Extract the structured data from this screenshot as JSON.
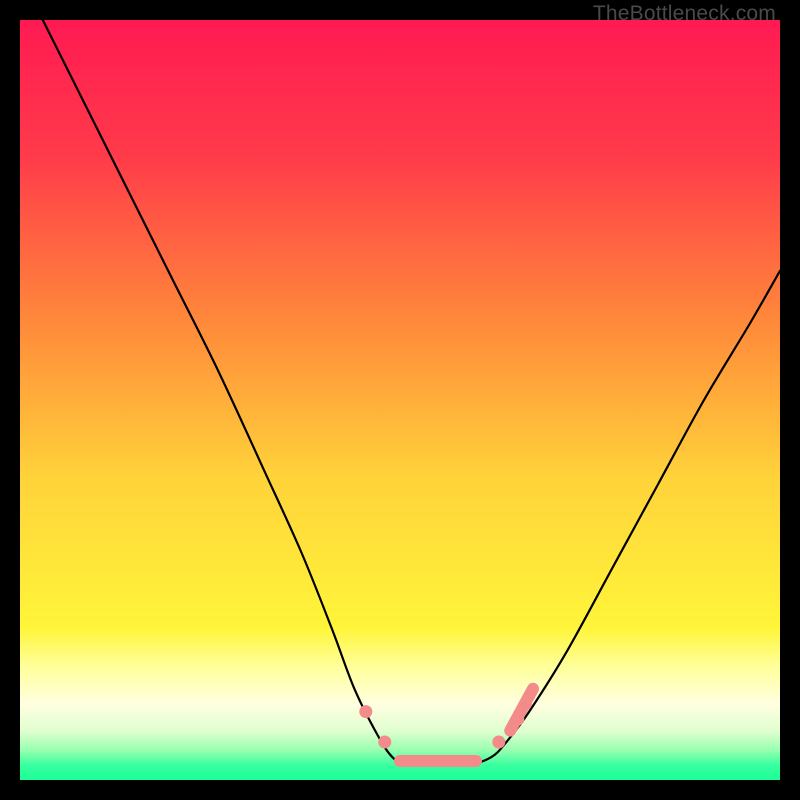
{
  "watermark": "TheBottleneck.com",
  "chart_data": {
    "type": "line",
    "title": "",
    "xlabel": "",
    "ylabel": "",
    "xlim": [
      0,
      100
    ],
    "ylim": [
      0,
      100
    ],
    "gradient_stops": [
      {
        "offset": 0,
        "color": "#ff1a52"
      },
      {
        "offset": 18,
        "color": "#ff3b4a"
      },
      {
        "offset": 40,
        "color": "#ff8a3a"
      },
      {
        "offset": 60,
        "color": "#ffd23a"
      },
      {
        "offset": 73,
        "color": "#ffe93a"
      },
      {
        "offset": 80,
        "color": "#fff53a"
      },
      {
        "offset": 85,
        "color": "#ffff99"
      },
      {
        "offset": 90,
        "color": "#ffffe0"
      },
      {
        "offset": 93.5,
        "color": "#e1ffd0"
      },
      {
        "offset": 96,
        "color": "#9affb0"
      },
      {
        "offset": 98,
        "color": "#3affa0"
      },
      {
        "offset": 100,
        "color": "#1aff98"
      }
    ],
    "series": [
      {
        "name": "bottleneck-curve",
        "x": [
          3,
          8,
          14,
          20,
          26,
          32,
          37,
          41,
          44,
          47,
          49,
          51,
          55,
          59,
          62,
          64,
          67,
          72,
          78,
          84,
          90,
          96,
          100
        ],
        "y": [
          100,
          90,
          78,
          66,
          54,
          41,
          30,
          20,
          12,
          6,
          3,
          2,
          2,
          2,
          3,
          5,
          9,
          17,
          28,
          39,
          50,
          60,
          67
        ]
      }
    ],
    "markers": {
      "color": "#f38b8b",
      "points": [
        {
          "x": 45.5,
          "y": 9
        },
        {
          "x": 48,
          "y": 5
        },
        {
          "x": 63,
          "y": 5
        },
        {
          "x": 65.5,
          "y": 8
        },
        {
          "x": 66.5,
          "y": 10
        }
      ],
      "segments": [
        {
          "x1": 50,
          "y1": 2.5,
          "x2": 60,
          "y2": 2.5
        },
        {
          "x1": 64.5,
          "y1": 6.5,
          "x2": 67.5,
          "y2": 12
        }
      ]
    }
  }
}
